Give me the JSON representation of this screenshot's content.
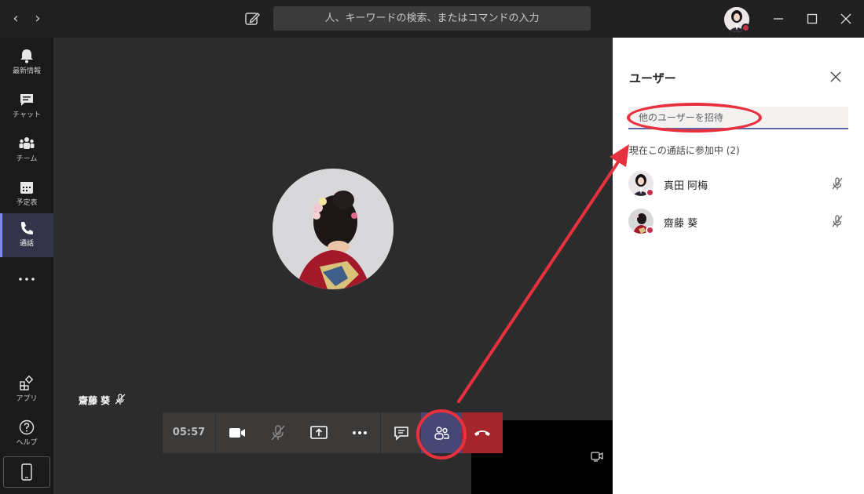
{
  "titlebar": {
    "search_placeholder": "人、キーワードの検索、またはコマンドの入力",
    "back_glyph": "‹",
    "forward_glyph": "›",
    "icons": [
      "chevron-left-icon",
      "chevron-right-icon",
      "compose-icon",
      "minimize-icon",
      "maximize-icon",
      "close-icon"
    ]
  },
  "rail": {
    "items": [
      {
        "label": "最新情報",
        "icon": "bell-icon"
      },
      {
        "label": "チャット",
        "icon": "chat-icon"
      },
      {
        "label": "チーム",
        "icon": "teams-icon"
      },
      {
        "label": "予定表",
        "icon": "calendar-icon"
      },
      {
        "label": "通話",
        "icon": "phone-icon",
        "active": true
      },
      {
        "label": "",
        "icon": "more-icon"
      }
    ],
    "bottom": [
      {
        "label": "アプリ",
        "icon": "apps-icon"
      },
      {
        "label": "ヘルプ",
        "icon": "help-icon"
      }
    ]
  },
  "stage": {
    "participant_name": "齋藤 葵"
  },
  "controls": {
    "timer": "05:57",
    "icons": [
      "video-icon",
      "mic-off-icon",
      "share-screen-icon",
      "more-actions-icon",
      "chat-icon",
      "people-icon",
      "hangup-icon"
    ]
  },
  "panel": {
    "title": "ユーザー",
    "invite_placeholder": "他のユーザーを招待",
    "section_label": "現在この通話に参加中 (2)",
    "participants": [
      {
        "name": "真田 阿梅",
        "muted": true
      },
      {
        "name": "齋藤 葵",
        "muted": true
      }
    ]
  },
  "colors": {
    "accent": "#6264a7",
    "annotation": "#e8313f",
    "hangup": "#a4262c",
    "rail_active": "#7f85f5"
  }
}
